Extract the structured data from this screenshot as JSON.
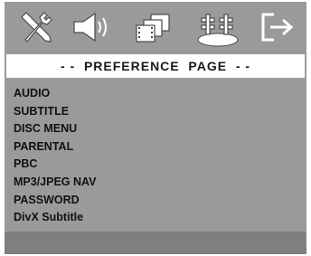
{
  "toolbar": {
    "icons": [
      {
        "name": "general-setup-icon"
      },
      {
        "name": "audio-setup-icon"
      },
      {
        "name": "video-setup-icon"
      },
      {
        "name": "preference-setup-icon",
        "selected": true
      },
      {
        "name": "exit-icon"
      }
    ]
  },
  "header": {
    "title": "- -  PREFERENCE  PAGE  - -"
  },
  "menu": {
    "items": [
      {
        "label": "AUDIO"
      },
      {
        "label": "SUBTITLE"
      },
      {
        "label": "DISC MENU"
      },
      {
        "label": "PARENTAL"
      },
      {
        "label": "PBC"
      },
      {
        "label": "MP3/JPEG NAV"
      },
      {
        "label": "PASSWORD"
      },
      {
        "label": "DivX Subtitle"
      }
    ]
  },
  "colors": {
    "panel_background": "#9a9a9a",
    "title_background": "#ffffff",
    "bottom_bar": "#7f7f7f",
    "icon_fill": "#ffffff"
  }
}
